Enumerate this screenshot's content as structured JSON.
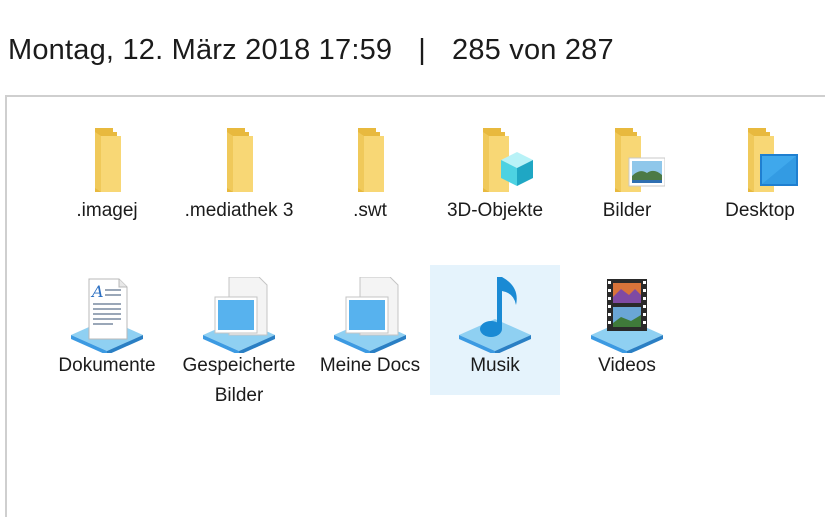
{
  "header": {
    "datetime": "Montag, 12. März 2018 17:59",
    "separator": "|",
    "counter": "285 von 287"
  },
  "items": [
    {
      "label": ".imagej",
      "icon": "folder-icon"
    },
    {
      "label": ".mediathek 3",
      "icon": "folder-icon"
    },
    {
      "label": ".swt",
      "icon": "folder-icon"
    },
    {
      "label": "3D-Objekte",
      "icon": "3d-objects-folder-icon"
    },
    {
      "label": "Bilder",
      "icon": "pictures-folder-icon"
    },
    {
      "label": "Desktop",
      "icon": "desktop-folder-icon"
    },
    {
      "label": "Dokumente",
      "icon": "documents-library-icon"
    },
    {
      "label": "Gespeicherte Bilder",
      "icon": "saved-pictures-library-icon"
    },
    {
      "label": "Meine Docs",
      "icon": "my-docs-library-icon"
    },
    {
      "label": "Musik",
      "icon": "music-library-icon",
      "selected": true
    },
    {
      "label": "Videos",
      "icon": "videos-library-icon"
    }
  ],
  "colors": {
    "folder": "#f8d775",
    "folder_dark": "#e8b93e",
    "selection": "#e5f3fc",
    "library_base": "#3c9ae2",
    "music_note": "#1a8ad4"
  }
}
